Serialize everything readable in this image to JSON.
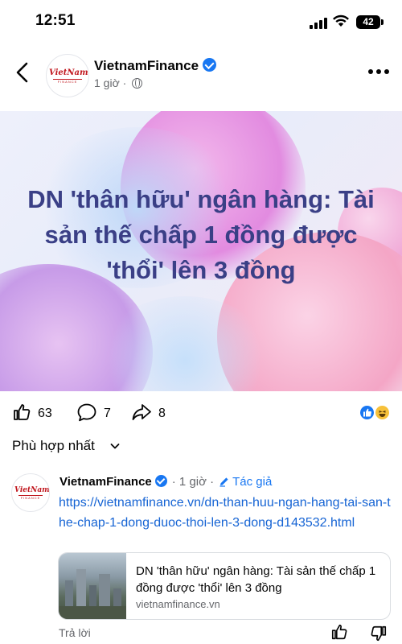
{
  "status_bar": {
    "time": "12:51",
    "battery": "42"
  },
  "post": {
    "page_name": "VietnamFinance",
    "time": "1 giờ",
    "meta_separator": "·",
    "avatar_logo": "VietNam",
    "avatar_logo_sub": "FINANCE",
    "banner_title": "DN 'thân hữu' ngân hàng: Tài sản thế chấp 1 đồng được 'thổi' lên 3 đồng",
    "likes": "63",
    "comments": "7",
    "shares": "8",
    "reactions": [
      "like",
      "haha"
    ]
  },
  "sort": {
    "label": "Phù hợp nhất"
  },
  "comment": {
    "author": "VietnamFinance",
    "time": "· 1 giờ ·",
    "author_badge": "Tác giả",
    "link_text": "https://vietnamfinance.vn/dn-than-huu-ngan-hang-tai-san-the-chap-1-dong-duoc-thoi-len-3-dong-d143532.html",
    "card_title": "DN 'thân hữu' ngân hàng: Tài sản thế chấp 1 đồng được 'thổi' lên 3 đồng",
    "card_domain": "vietnamfinance.vn",
    "reply_label": "Trả lời"
  },
  "colors": {
    "accent": "#1877f2",
    "link": "#1664d4",
    "banner_text": "#3a3f86",
    "logo_red": "#c0161d"
  },
  "icons": [
    "back-arrow-icon",
    "verified-icon",
    "globe-icon",
    "more-icon",
    "like-icon",
    "comment-icon",
    "share-icon",
    "chevron-down-icon",
    "edit-icon",
    "dislike-icon"
  ]
}
